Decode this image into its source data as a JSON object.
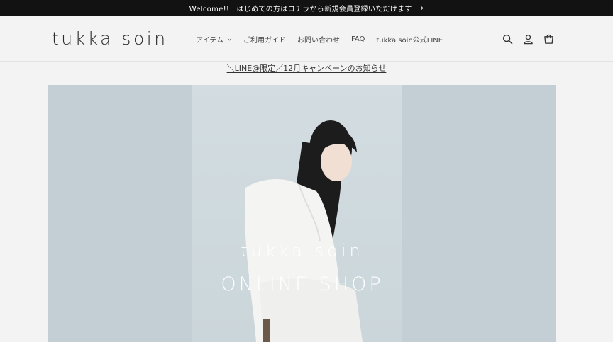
{
  "announcement": {
    "text": "Welcome!!　はじめての方はコチラから新規会員登録いただけます",
    "arrow": "→"
  },
  "header": {
    "logo": "tukka soin",
    "nav": [
      {
        "label": "アイテム",
        "has_dropdown": true
      },
      {
        "label": "ご利用ガイド"
      },
      {
        "label": "お問い合わせ"
      },
      {
        "label": "FAQ"
      },
      {
        "label": "tukka soin公式LINE"
      }
    ],
    "icons": [
      "search-icon",
      "account-icon",
      "cart-icon"
    ]
  },
  "campaign_link": "＼LINE@限定／12月キャンペーンのお知らせ",
  "hero": {
    "title": "tukka soin",
    "subtitle": "ONLINE SHOP",
    "background": "#c3ced5"
  }
}
